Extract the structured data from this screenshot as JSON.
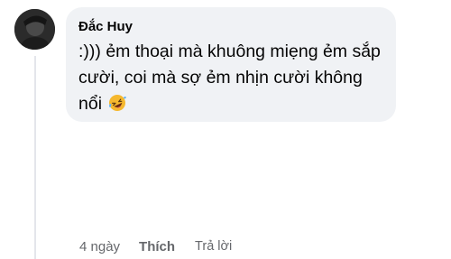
{
  "comment": {
    "author": "Đắc Huy",
    "text": ":))) ẻm thoại mà khuông miẹng ẻm sắp cười, coi mà sợ ẻm nhịn cười không nổi",
    "emoji": "rolling-on-floor-laughing-emoji"
  },
  "actions": {
    "time": "4 ngày",
    "like_label": "Thích",
    "reply_label": "Trả lời"
  },
  "colors": {
    "bubble_bg": "#f0f2f5",
    "meta_text": "#65676b",
    "body_text": "#050505"
  }
}
